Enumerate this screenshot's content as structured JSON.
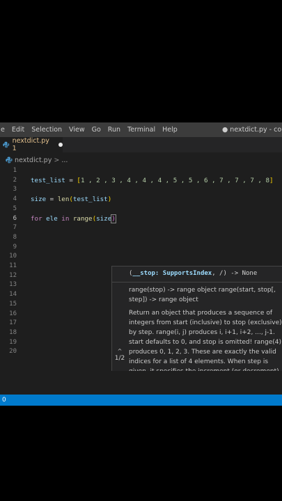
{
  "menubar": {
    "items": [
      "e",
      "Edit",
      "Selection",
      "View",
      "Go",
      "Run",
      "Terminal",
      "Help"
    ],
    "window_title": "● nextdict.py - courser"
  },
  "tab": {
    "label": "nextdict.py 1"
  },
  "breadcrumb": {
    "file": "nextdict.py",
    "sep": ">",
    "rest": "..."
  },
  "code": {
    "line2": {
      "var": "test_list",
      "op": " = ",
      "open": "[",
      "body": "1 , 2 , 3 , 4 , 4 , 4 , 5 , 5 , 6 , 7 , 7 , 7 , 8",
      "close": "]"
    },
    "line4": {
      "var": "size",
      "op": " = ",
      "fn": "len",
      "open": "(",
      "arg": "test_list",
      "close": ")"
    },
    "line6": {
      "kw_for": "for",
      "var": " ele ",
      "kw_in": "in",
      "fn": " range",
      "open": "(",
      "arg": "size",
      "close": ")"
    }
  },
  "hover": {
    "signature_open": "(",
    "param": "__stop: SupportsIndex",
    "signature_rest": ", /) -> None",
    "doc_summary": "range(stop) -> range object range(start, stop[, step]) -> range object",
    "doc_body": "Return an object that produces a sequence of integers from start (inclusive) to stop (exclusive) by step. range(i, j) produces i, i+1, i+2, ..., j-1. start defaults to 0, and stop is omitted! range(4) produces 0, 1, 2, 3. These are exactly the valid indices for a list of 4 elements. When step is given, it specifies the increment (or decrement).",
    "page": "1/2"
  },
  "status": {
    "errors": "0"
  },
  "colors": {
    "status_bar": "#007acc",
    "editor_bg": "#1e1e1e",
    "menubar_bg": "#3c3c3c"
  }
}
